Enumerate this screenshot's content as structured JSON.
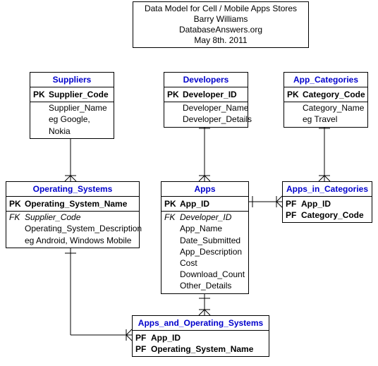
{
  "header": {
    "line1": "Data Model for Cell / Mobile Apps Stores",
    "line2": "Barry Williams",
    "line3": "DatabaseAnswers.org",
    "line4": "May 8th. 2011"
  },
  "entities": {
    "suppliers": {
      "title": "Suppliers",
      "pk_label": "PK",
      "pk_attr": "Supplier_Code",
      "attrs": [
        "Supplier_Name",
        "eg Google, Nokia"
      ]
    },
    "developers": {
      "title": "Developers",
      "pk_label": "PK",
      "pk_attr": "Developer_ID",
      "attrs": [
        "Developer_Name",
        "Developer_Details"
      ]
    },
    "app_categories": {
      "title": "App_Categories",
      "pk_label": "PK",
      "pk_attr": "Category_Code",
      "attrs": [
        "Category_Name",
        "eg Travel"
      ]
    },
    "operating_systems": {
      "title": "Operating_Systems",
      "pk_label": "PK",
      "pk_attr": "Operating_System_Name",
      "fk_label": "FK",
      "fk_attr": "Supplier_Code",
      "attrs": [
        "Operating_System_Description",
        "eg Android, Windows Mobile"
      ]
    },
    "apps": {
      "title": "Apps",
      "pk_label": "PK",
      "pk_attr": "App_ID",
      "fk_label": "FK",
      "fk_attr": "Developer_ID",
      "attrs": [
        "App_Name",
        "Date_Submitted",
        "App_Description",
        "Cost",
        "Download_Count",
        "Other_Details"
      ]
    },
    "apps_in_categories": {
      "title": "Apps_in_Categories",
      "pf_label": "PF",
      "pf1": "App_ID",
      "pf2": "Category_Code"
    },
    "apps_and_os": {
      "title": "Apps_and_Operating_Systems",
      "pf_label": "PF",
      "pf1": "App_ID",
      "pf2": "Operating_System_Name"
    }
  }
}
